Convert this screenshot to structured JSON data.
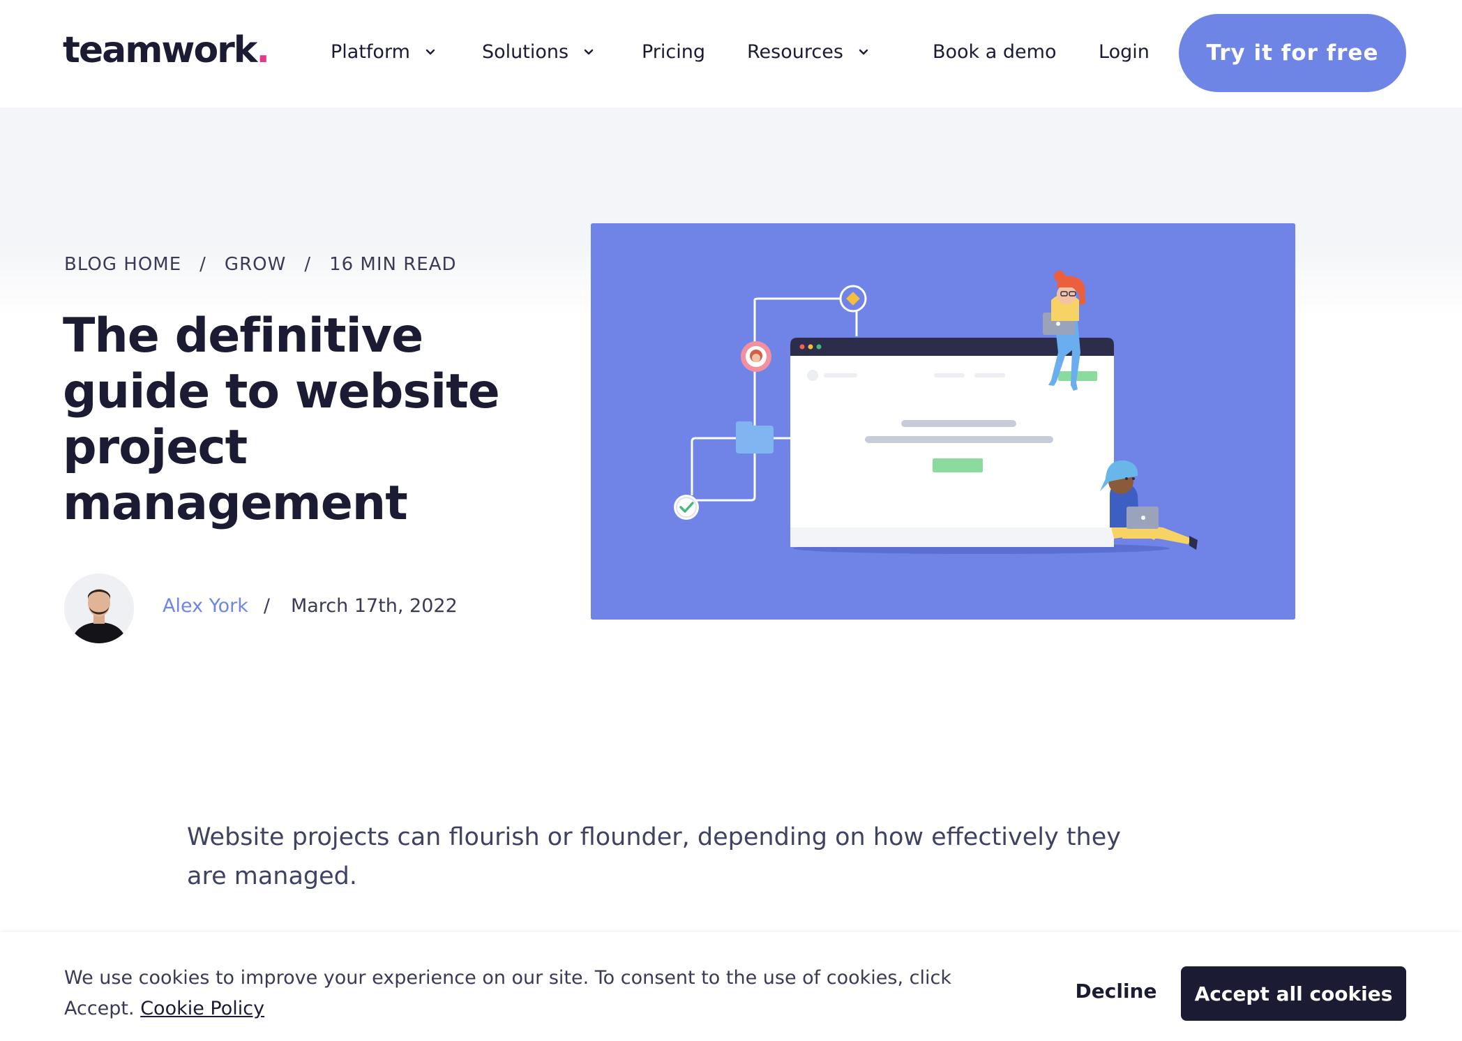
{
  "header": {
    "logo_text": "teamwork",
    "logo_dot": ".",
    "nav": {
      "platform": "Platform",
      "solutions": "Solutions",
      "pricing": "Pricing",
      "resources": "Resources",
      "book_demo": "Book a demo",
      "login": "Login"
    },
    "cta": "Try it for free"
  },
  "breadcrumb": {
    "home": "BLOG HOME",
    "category": "GROW",
    "read_time": "16 MIN READ",
    "separator": "/"
  },
  "article": {
    "title": "The definitive guide to website project management",
    "author": "Alex York",
    "date": "March 17th, 2022",
    "intro": "Website projects can flourish or flounder, depending on how effectively they are managed."
  },
  "cookie_banner": {
    "text": "We use cookies to improve your experience on our site. To consent to the use of cookies, click Accept.",
    "policy_link": "Cookie Policy",
    "decline": "Decline",
    "accept": "Accept all cookies"
  },
  "colors": {
    "accent": "#6f85e6",
    "dark": "#1b1b34",
    "logo_dot": "#e5398f",
    "illustration_bg": "#6f84e6"
  }
}
